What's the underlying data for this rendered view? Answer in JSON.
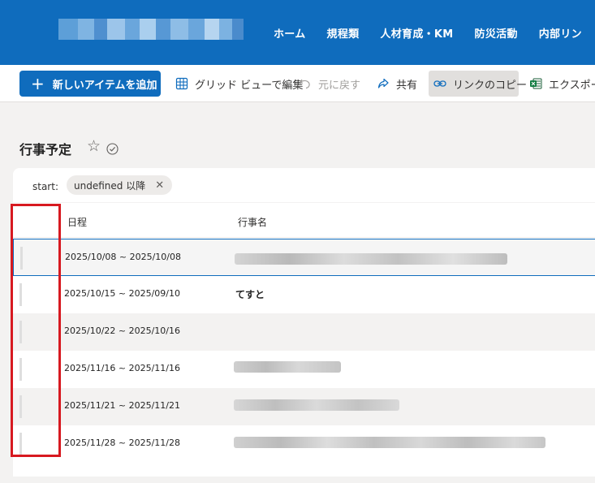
{
  "nav": {
    "items": [
      "ホーム",
      "規程類",
      "人材育成・KM",
      "防災活動",
      "内部リン"
    ]
  },
  "toolbar": {
    "new_item_label": "新しいアイテムを追加",
    "grid_edit_label": "グリッド ビューで編集",
    "undo_label": "元に戻す",
    "share_label": "共有",
    "copy_link_label": "リンクのコピー",
    "export_label": "エクスポート"
  },
  "page": {
    "title": "行事予定"
  },
  "filter": {
    "label": "start:",
    "pill_text": "undefined 以降"
  },
  "list": {
    "columns": [
      "日程",
      "行事名"
    ],
    "rows": [
      {
        "date": "2025/10/08 ~ 2025/10/08",
        "name": ""
      },
      {
        "date": "2025/10/15 ~ 2025/09/10",
        "name": "てすと"
      },
      {
        "date": "2025/10/22 ~ 2025/10/16",
        "name": ""
      },
      {
        "date": "2025/11/16 ~ 2025/11/16",
        "name": ""
      },
      {
        "date": "2025/11/21 ~ 2025/11/21",
        "name": ""
      },
      {
        "date": "2025/11/28 ~ 2025/11/28",
        "name": ""
      }
    ]
  },
  "icons": {
    "favorite": "star-outline-icon",
    "follow": "check-circle-icon",
    "grid": "grid-icon",
    "undo": "undo-icon",
    "share": "share-icon",
    "link": "link-icon",
    "excel": "excel-icon"
  },
  "colors": {
    "brand": "#0f6cbd",
    "highlight_frame": "#d71920"
  }
}
